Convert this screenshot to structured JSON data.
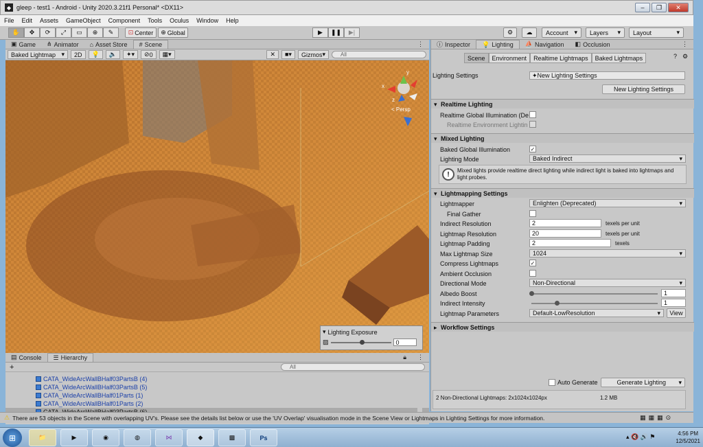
{
  "window": {
    "title": "gleep - test1 - Android - Unity 2020.3.21f1 Personal* <DX11>"
  },
  "menu": [
    "File",
    "Edit",
    "Assets",
    "GameObject",
    "Component",
    "Tools",
    "Oculus",
    "Window",
    "Help"
  ],
  "toolbar": {
    "pivot_label": "Center",
    "space_label": "Global",
    "account_label": "Account",
    "layers_label": "Layers",
    "layout_label": "Layout"
  },
  "left_tabs": [
    "Game",
    "Animator",
    "Asset Store",
    "Scene"
  ],
  "scene_toolbar": {
    "shading_mode": "Baked Lightmap",
    "two_d": "2D",
    "hidden_count": "0",
    "gizmos_label": "Gizmos",
    "search_placeholder": "All"
  },
  "gizmo": {
    "persp_label": "< Persp",
    "axis_y": "y",
    "axis_x": "x",
    "axis_z": "z"
  },
  "lighting_exposure": {
    "title": "Lighting Exposure",
    "value": "0",
    "level": 0.5
  },
  "bottom_tabs": [
    "Console",
    "Hierarchy"
  ],
  "hierarchy": {
    "search_placeholder": "All",
    "add_label": "+",
    "items": [
      {
        "label": "CATA_WideArcWallBHalf03PartsB (4)",
        "selected": false
      },
      {
        "label": "CATA_WideArcWallBHalf03PartsB (5)",
        "selected": false
      },
      {
        "label": "CATA_WideArcWallBHalf01Parts (1)",
        "selected": false
      },
      {
        "label": "CATA_WideArcWallBHalf01Parts (2)",
        "selected": false
      },
      {
        "label": "CATA_WideArcWallBHalf03PartsB (6)",
        "selected": true
      }
    ]
  },
  "right_tabs": [
    "Inspector",
    "Lighting",
    "Navigation",
    "Occlusion"
  ],
  "lighting_subtabs": [
    "Scene",
    "Environment",
    "Realtime Lightmaps",
    "Baked Lightmaps"
  ],
  "lighting": {
    "settings_label": "Lighting Settings",
    "settings_value": "New Lighting Settings",
    "new_settings_button": "New Lighting Settings",
    "realtime": {
      "header": "Realtime Lighting",
      "gi_label": "Realtime Global Illumination (De",
      "gi_checked": false,
      "env_label": "Realtime Environment Lightin",
      "env_checked": false
    },
    "mixed": {
      "header": "Mixed Lighting",
      "baked_gi_label": "Baked Global Illumination",
      "baked_gi_checked": true,
      "mode_label": "Lighting Mode",
      "mode_value": "Baked Indirect",
      "info": "Mixed lights provide realtime direct lighting while indirect light is baked into lightmaps and light probes.",
      "info_icon": "!"
    },
    "lightmapping": {
      "header": "Lightmapping Settings",
      "lightmapper_label": "Lightmapper",
      "lightmapper_value": "Enlighten (Deprecated)",
      "final_gather_label": "Final Gather",
      "final_gather_checked": false,
      "indirect_res_label": "Indirect Resolution",
      "indirect_res_value": "2",
      "indirect_res_unit": "texels per unit",
      "lightmap_res_label": "Lightmap Resolution",
      "lightmap_res_value": "20",
      "lightmap_res_unit": "texels per unit",
      "padding_label": "Lightmap Padding",
      "padding_value": "2",
      "padding_unit": "texels",
      "max_size_label": "Max Lightmap Size",
      "max_size_value": "1024",
      "compress_label": "Compress Lightmaps",
      "compress_checked": true,
      "ao_label": "Ambient Occlusion",
      "ao_checked": false,
      "directional_label": "Directional Mode",
      "directional_value": "Non-Directional",
      "albedo_label": "Albedo Boost",
      "albedo_value": "1",
      "albedo_level": 0.0,
      "indirect_int_label": "Indirect Intensity",
      "indirect_int_value": "1",
      "indirect_int_level": 0.2,
      "params_label": "Lightmap Parameters",
      "params_value": "Default-LowResolution",
      "view_button": "View"
    },
    "workflow": {
      "header": "Workflow Settings"
    },
    "auto_generate_label": "Auto Generate",
    "auto_generate_checked": false,
    "generate_button": "Generate Lighting",
    "stats_left": "2 Non-Directional Lightmaps: 2x1024x1024px",
    "stats_right": "1.2 MB"
  },
  "status": {
    "message": "There are 53 objects in the Scene with overlapping UV's. Please see the details list below or use the 'UV Overlap' visualisation mode in the Scene View or Lightmaps in Lighting Settings for more information."
  },
  "taskbar": {
    "time": "4:56 PM",
    "date": "12/5/2021"
  },
  "colors": {
    "accent_scene": "#b46a2a",
    "hierarchy_link": "#1a3fa8",
    "warning": "#e6b800"
  }
}
